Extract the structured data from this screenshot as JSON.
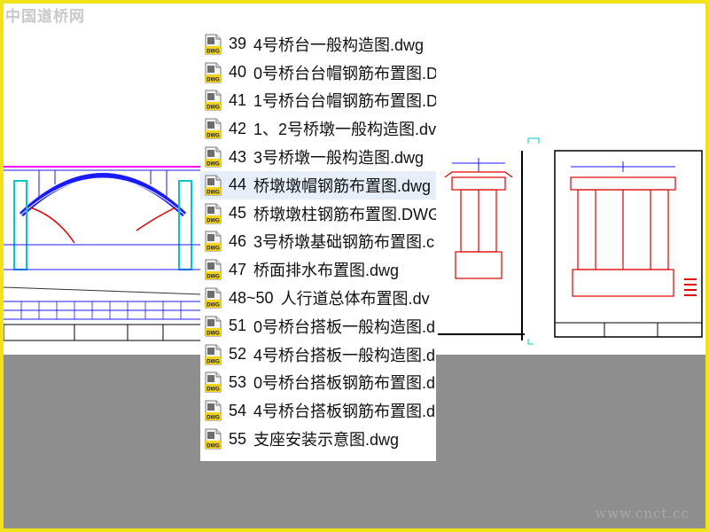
{
  "watermark": "中国道桥网",
  "watermark_bottom": "www.cnct.cc",
  "colors": {
    "border": "#f2e21a",
    "grey_area": "#8e8e8e",
    "selected_row": "#e6eef9",
    "cad_red": "#e00000",
    "cad_blue": "#1a1aff",
    "cad_cyan": "#00c8c8",
    "cad_magenta": "#ff00ff"
  },
  "files": [
    {
      "num": "39",
      "name": "4号桥台一般构造图.dwg",
      "icon": "dwg-file-icon"
    },
    {
      "num": "40",
      "name": "0号桥台台帽钢筋布置图.D",
      "icon": "dwg-file-icon"
    },
    {
      "num": "41",
      "name": "1号桥台台帽钢筋布置图.D",
      "icon": "dwg-file-icon"
    },
    {
      "num": "42",
      "name": "1、2号桥墩一般构造图.dv",
      "icon": "dwg-file-icon"
    },
    {
      "num": "43",
      "name": "3号桥墩一般构造图.dwg",
      "icon": "dwg-file-icon"
    },
    {
      "num": "44",
      "name": "桥墩墩帽钢筋布置图.dwg",
      "icon": "dwg-file-icon",
      "selected": true
    },
    {
      "num": "45",
      "name": "桥墩墩柱钢筋布置图.DWG",
      "icon": "dwg-file-icon"
    },
    {
      "num": "46",
      "name": "3号桥墩基础钢筋布置图.c",
      "icon": "dwg-file-icon"
    },
    {
      "num": "47",
      "name": "桥面排水布置图.dwg",
      "icon": "dwg-file-icon"
    },
    {
      "num": "48~50",
      "name": "人行道总体布置图.dv",
      "icon": "dwg-file-icon"
    },
    {
      "num": "51",
      "name": "0号桥台搭板一般构造图.d",
      "icon": "dwg-file-icon"
    },
    {
      "num": "52",
      "name": "4号桥台搭板一般构造图.d",
      "icon": "dwg-file-icon"
    },
    {
      "num": "53",
      "name": "0号桥台搭板钢筋布置图.d",
      "icon": "dwg-file-icon"
    },
    {
      "num": "54",
      "name": "4号桥台搭板钢筋布置图.d",
      "icon": "dwg-file-icon"
    },
    {
      "num": "55",
      "name": "支座安装示意图.dwg",
      "icon": "dwg-file-icon"
    }
  ]
}
